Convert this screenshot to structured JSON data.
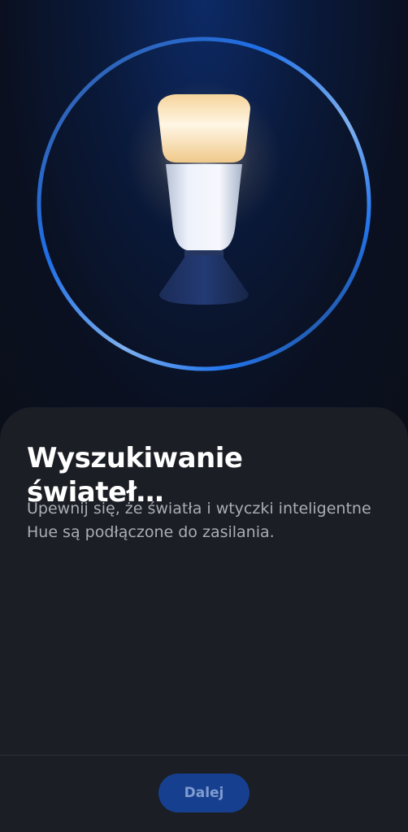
{
  "hero": {
    "illustration": "bulb-icon",
    "ring_colors": [
      "#4f86df",
      "#1f6fe6",
      "#8ab2ea",
      "#2a3650"
    ]
  },
  "sheet": {
    "title": "Wyszukiwanie świateł…",
    "description": "Upewnij się, że światła i wtyczki inteligentne Hue są podłączone do zasilania."
  },
  "footer": {
    "next_label": "Dalej",
    "button_color": "#163f8f"
  }
}
